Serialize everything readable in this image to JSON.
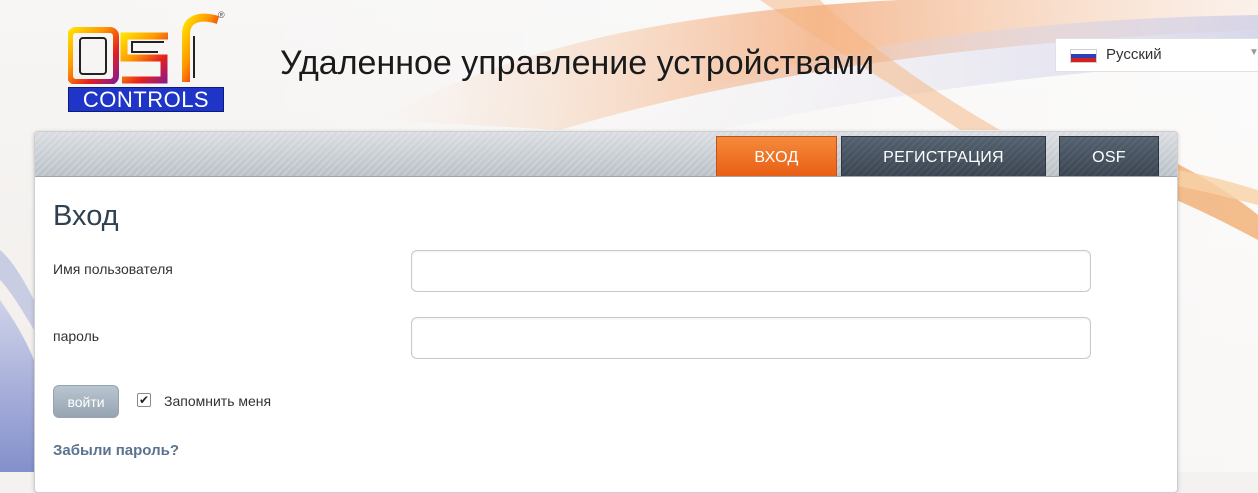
{
  "header": {
    "logo_letters": "osf",
    "logo_sub": "CONTROLS",
    "logo_reg": "®",
    "title": "Удаленное управление устройствами"
  },
  "language": {
    "selected": "Русский",
    "arrow_icon": "▼",
    "flag": "russia-flag-icon"
  },
  "nav": {
    "tabs": [
      {
        "label": "ВХОД",
        "active": true
      },
      {
        "label": "РЕГИСТРАЦИЯ",
        "active": false
      },
      {
        "label": "OSF",
        "active": false
      }
    ]
  },
  "form": {
    "heading": "Вход",
    "username_label": "Имя пользователя",
    "username_value": "",
    "password_label": "пароль",
    "password_value": "",
    "login_button": "войти",
    "remember_label": "Запомнить меня",
    "remember_checked": true,
    "remember_check_glyph": "✔",
    "forgot_link": "Забыли пароль?"
  },
  "colors": {
    "active_tab": "#e8641a",
    "dark_tab": "#3f4a56",
    "heading": "#2f4151",
    "link": "#5a7390",
    "logo_blue": "#1f35c8"
  }
}
